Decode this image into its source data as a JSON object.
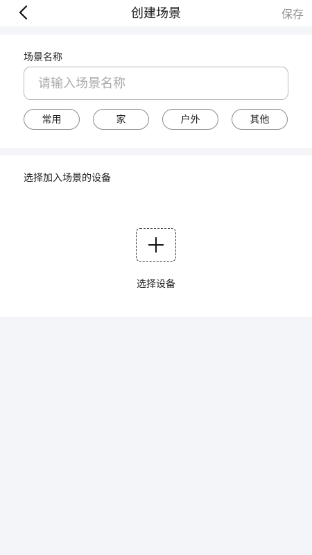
{
  "header": {
    "title": "创建场景",
    "save_label": "保存",
    "back_icon": "chevron-left-icon"
  },
  "scene_name": {
    "label": "场景名称",
    "value": "",
    "placeholder": "请输入场景名称",
    "tags": [
      "常用",
      "家",
      "户外",
      "其他"
    ]
  },
  "devices": {
    "label": "选择加入场景的设备",
    "add_icon": "plus-icon",
    "add_label": "选择设备"
  },
  "colors": {
    "background": "#f4f5f9",
    "card": "#ffffff",
    "text": "#222222",
    "placeholder": "#a8a8a8",
    "save": "#8e8e8e"
  }
}
